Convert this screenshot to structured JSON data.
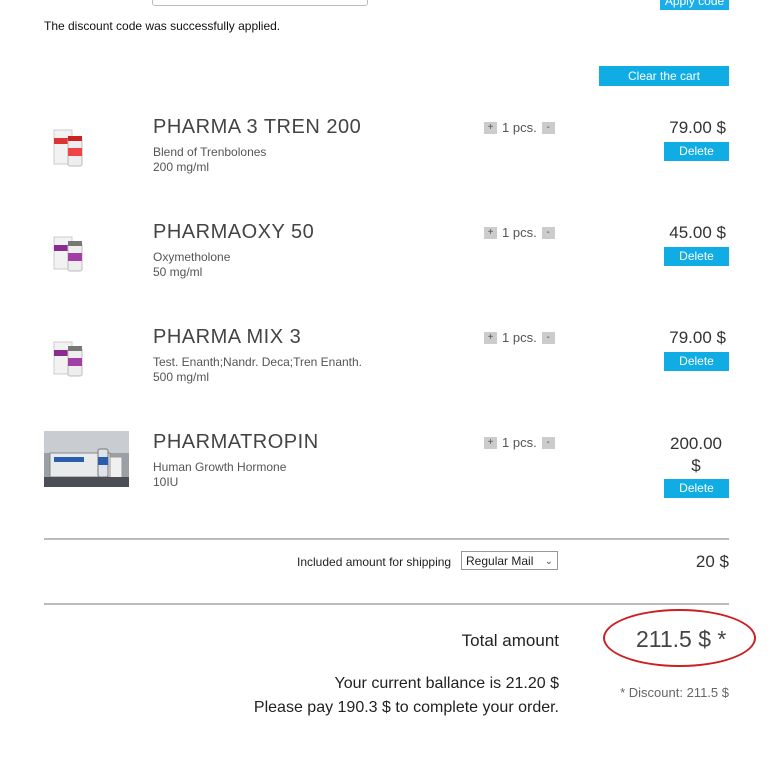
{
  "discount": {
    "apply_label": "Apply code",
    "message": "The discount code was successfully applied."
  },
  "cart": {
    "clear_label": "Clear the cart",
    "items": [
      {
        "name": "PHARMA 3 TREN 200",
        "desc1": "Blend of Trenbolones",
        "desc2": "200 mg/ml",
        "qty": "1 pcs.",
        "price": "79.00 $",
        "delete_label": "Delete"
      },
      {
        "name": "PHARMAOXY 50",
        "desc1": "Oxymetholone",
        "desc2": "50 mg/ml",
        "qty": "1 pcs.",
        "price": "45.00 $",
        "delete_label": "Delete"
      },
      {
        "name": "PHARMA MIX 3",
        "desc1": "Test. Enanth;Nandr. Deca;Tren Enanth.",
        "desc2": "500 mg/ml",
        "qty": "1 pcs.",
        "price": "79.00 $",
        "delete_label": "Delete"
      },
      {
        "name": "PHARMATROPIN",
        "desc1": "Human Growth Hormone",
        "desc2": "10IU",
        "qty": "1 pcs.",
        "price_line1": "200.00",
        "price_line2": "$",
        "delete_label": "Delete"
      }
    ],
    "plus": "+",
    "minus": "-"
  },
  "shipping": {
    "label": "Included amount for shipping",
    "selected": "Regular Mail",
    "price": "20 $"
  },
  "summary": {
    "total_label": "Total amount",
    "total_value": "211.5 $ *",
    "balance_text": "Your current ballance is 21.20 $",
    "pay_text": "Please pay 190.3 $ to complete your order.",
    "discount_note": "* Discount: 211.5 $"
  },
  "colors": {
    "accent": "#10ace4",
    "highlight_ring": "#cc1f1f"
  }
}
